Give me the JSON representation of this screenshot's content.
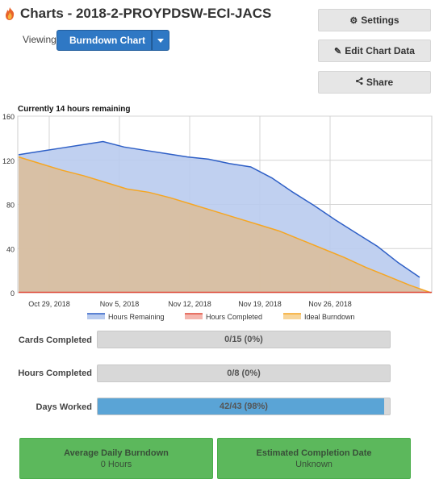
{
  "header": {
    "title": "Charts - 2018-2-PROYPDSW-ECI-JACS",
    "viewing_label": "Viewing",
    "view_selected": "Burndown Chart"
  },
  "actions": {
    "settings": "Settings",
    "edit_chart_data": "Edit Chart Data",
    "share": "Share"
  },
  "chart_caption": "Currently 14 hours remaining",
  "colors": {
    "remaining_line": "#2e5fc6",
    "remaining_fill": "#b9cbee",
    "ideal_line": "#f5a623",
    "ideal_fill": "#d9bfa0",
    "completed_line": "#e04b3a",
    "accent": "#2f78c4",
    "progress_fill": "#5aa4d6",
    "card_green": "#5cb85c"
  },
  "chart_data": {
    "type": "area",
    "title": "",
    "xlabel": "",
    "ylabel": "",
    "ylim": [
      0,
      160
    ],
    "yticks": [
      0,
      40,
      80,
      120,
      160
    ],
    "xticks": [
      "Oct 29, 2018",
      "Nov 5, 2018",
      "Nov 12, 2018",
      "Nov 19, 2018",
      "Nov 26, 2018"
    ],
    "x_range": [
      "Oct 26, 2018",
      "Dec 8, 2018"
    ],
    "grid": true,
    "legend_position": "bottom",
    "series": [
      {
        "name": "Hours Remaining",
        "x": [
          "2018-10-26",
          "2018-10-27",
          "2018-10-28",
          "2018-10-29",
          "2018-10-30",
          "2018-10-31",
          "2018-11-01",
          "2018-11-02",
          "2018-11-03",
          "2018-11-04",
          "2018-11-04b",
          "2018-11-05",
          "2018-11-09",
          "2018-11-13",
          "2018-11-17",
          "2018-11-21",
          "2018-11-25",
          "2018-11-29",
          "2018-12-03",
          "2018-12-07"
        ],
        "values": [
          125,
          128,
          131,
          134,
          137,
          132,
          129,
          126,
          123,
          121,
          117,
          114,
          104,
          91,
          79,
          66,
          54,
          42,
          27,
          14
        ]
      },
      {
        "name": "Hours Completed",
        "values": [
          0,
          0
        ]
      },
      {
        "name": "Ideal Burndown",
        "values": [
          123,
          117,
          111,
          106,
          100,
          94,
          91,
          86,
          80,
          74,
          68,
          62,
          56,
          48,
          40,
          32,
          23,
          15,
          7,
          0
        ]
      }
    ]
  },
  "stats": [
    {
      "label": "Cards Completed",
      "value": "0/15 (0%)",
      "percent": 0
    },
    {
      "label": "Hours Completed",
      "value": "0/8 (0%)",
      "percent": 0
    },
    {
      "label": "Days Worked",
      "value": "42/43 (98%)",
      "percent": 98
    }
  ],
  "cards": [
    {
      "title": "Average Daily Burndown",
      "value": "0 Hours"
    },
    {
      "title": "Estimated Completion Date",
      "value": "Unknown"
    }
  ]
}
